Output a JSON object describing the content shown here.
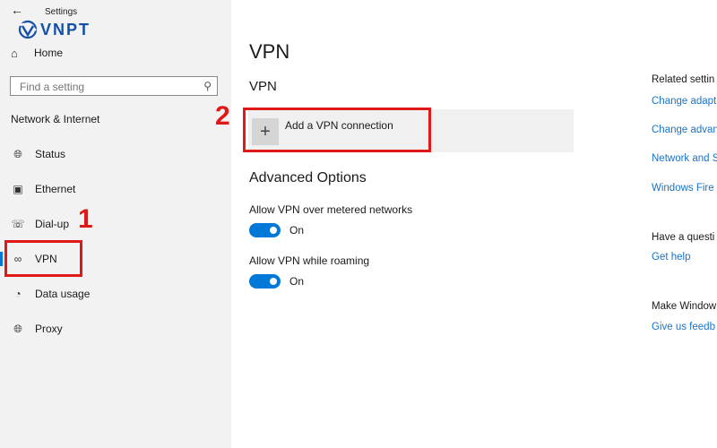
{
  "window": {
    "title": "Settings"
  },
  "brand": {
    "logo_text": "VNPT",
    "color": "#1550a8"
  },
  "sidebar": {
    "home_label": "Home",
    "search_placeholder": "Find a setting",
    "section_title": "Network & Internet",
    "items": [
      {
        "label": "Status",
        "icon": "globe-icon"
      },
      {
        "label": "Ethernet",
        "icon": "ethernet-icon"
      },
      {
        "label": "Dial-up",
        "icon": "dialup-icon"
      },
      {
        "label": "VPN",
        "icon": "vpn-icon",
        "selected": true
      },
      {
        "label": "Data usage",
        "icon": "data-usage-icon"
      },
      {
        "label": "Proxy",
        "icon": "globe-icon"
      }
    ]
  },
  "annotations": {
    "step1": "1",
    "step2": "2",
    "color": "#e01818"
  },
  "main": {
    "title": "VPN",
    "section_title": "VPN",
    "add_vpn_label": "Add a VPN connection",
    "advanced_title": "Advanced Options",
    "options": [
      {
        "label": "Allow VPN over metered networks",
        "state": "On"
      },
      {
        "label": "Allow VPN while roaming",
        "state": "On"
      }
    ]
  },
  "related": {
    "heading": "Related settin",
    "links": [
      "Change adapt",
      "Change advan",
      "Network and S",
      "Windows Fire"
    ],
    "question_heading": "Have a questi",
    "help_link": "Get help",
    "feedback_heading": "Make Window",
    "feedback_link": "Give us feedb"
  },
  "colors": {
    "accent": "#0078d7",
    "link": "#1a73c8"
  }
}
